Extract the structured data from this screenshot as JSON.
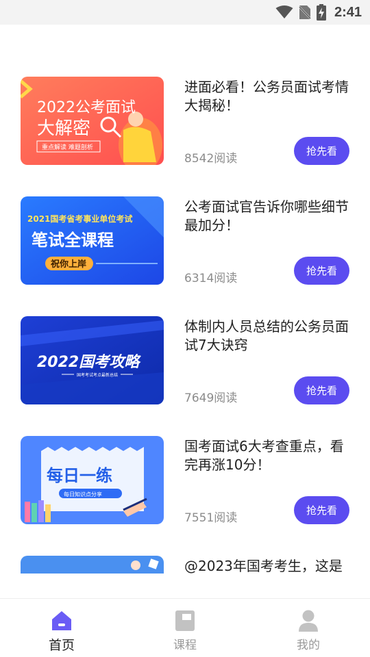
{
  "status_bar": {
    "time": "2:41"
  },
  "articles": [
    {
      "title": "进面必看！公务员面试考情大揭秘！",
      "reads": "8542阅读",
      "button": "抢先看",
      "thumb": {
        "line1": "2022公考面试",
        "line2": "大解密",
        "tag": "重点解读 难题剖析"
      }
    },
    {
      "title": "公考面试官告诉你哪些细节最加分！",
      "reads": "6314阅读",
      "button": "抢先看",
      "thumb": {
        "line1": "2021国考省考事业单位考试",
        "line2": "笔试全课程",
        "tag": "祝你上岸"
      }
    },
    {
      "title": "体制内人员总结的公务员面试7大诀窍",
      "reads": "7649阅读",
      "button": "抢先看",
      "thumb": {
        "line1": "2022国考攻略",
        "tag": "国考考试考点最新总结"
      }
    },
    {
      "title": "国考面试6大考查重点，看完再涨10分！",
      "reads": "7551阅读",
      "button": "抢先看",
      "thumb": {
        "line1": "每日一练",
        "tag": "每日知识点分享"
      }
    },
    {
      "title": "@2023年国考考生，这是"
    }
  ],
  "tabs": [
    {
      "label": "首页",
      "active": true
    },
    {
      "label": "课程",
      "active": false
    },
    {
      "label": "我的",
      "active": false
    }
  ],
  "colors": {
    "accent": "#5b4cf0",
    "home_icon": "#6a5cf5",
    "inactive_icon": "#c2c2c2"
  }
}
